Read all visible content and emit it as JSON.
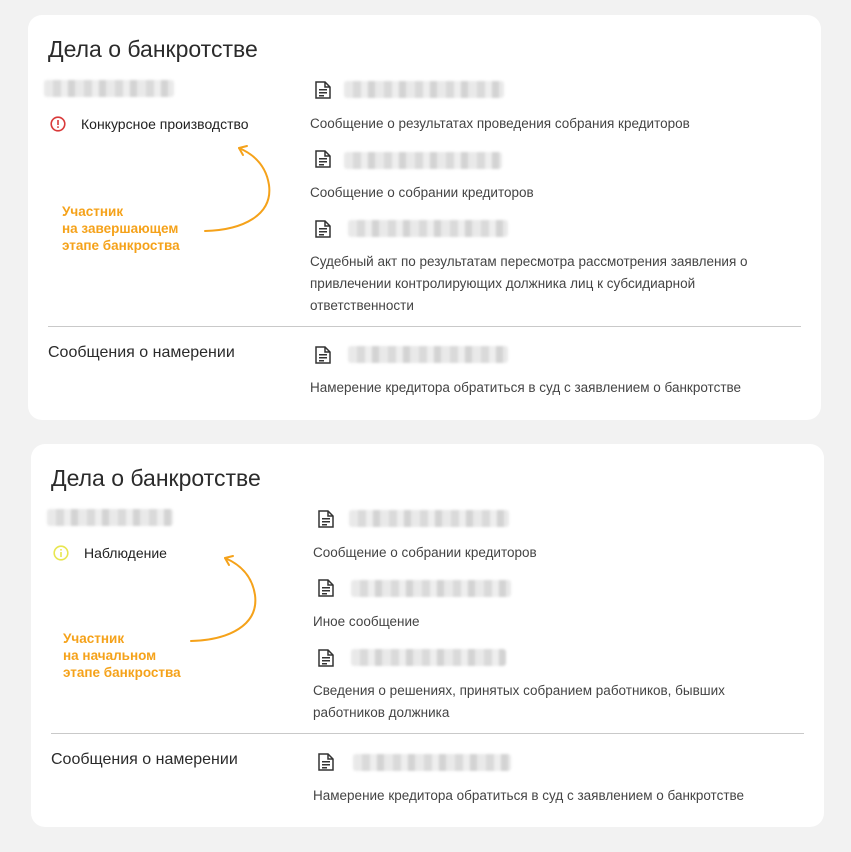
{
  "cards": [
    {
      "title": "Дела о банкротстве",
      "status": "Конкурсное производство",
      "note_lines": [
        "Участник",
        "на завершающем",
        "этапе банкроства"
      ],
      "messages": [
        "Сообщение о результатах проведения собрания кредиторов",
        "Сообщение о собрании кредиторов",
        "Судебный акт по результатам пересмотра рассмотрения заявления о привлечении контролирующих должника лиц к субсидиарной ответственности"
      ],
      "intent_label": "Сообщения о намерении",
      "intent_message": "Намерение кредитора обратиться в суд с заявлением о банкротстве"
    },
    {
      "title": "Дела о банкротстве",
      "status": "Наблюдение",
      "note_lines": [
        "Участник",
        "на начальном",
        "этапе банкроства"
      ],
      "messages": [
        "Сообщение о собрании кредиторов",
        "Иное сообщение",
        "Сведения о решениях, принятых собранием работников, бывших работников должника"
      ],
      "intent_label": "Сообщения о намерении",
      "intent_message": "Намерение кредитора обратиться в суд с заявлением о банкротстве"
    }
  ],
  "icons": {
    "status_1": "alert-circle-icon",
    "status_2": "info-circle-icon",
    "document": "document-icon",
    "arrow": "curved-arrow-icon"
  },
  "colors": {
    "accent": "#f5a21a",
    "danger": "#d93a3a",
    "warning": "#e8e650"
  }
}
